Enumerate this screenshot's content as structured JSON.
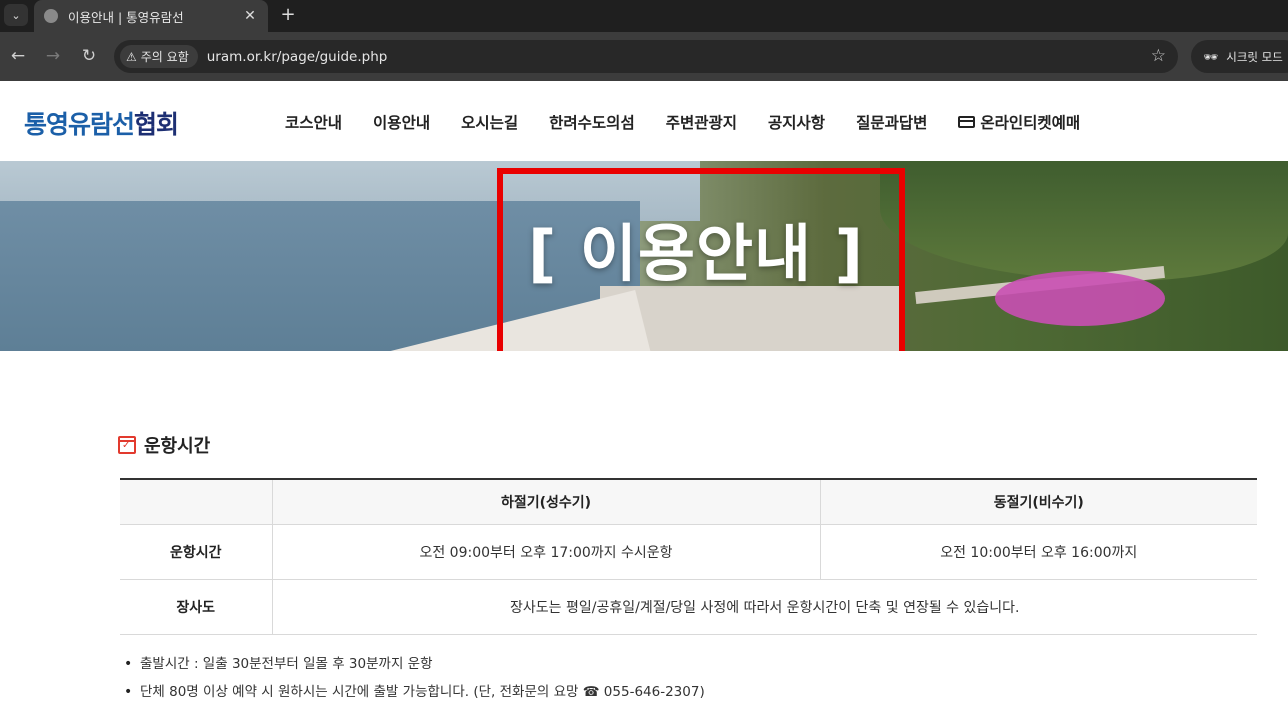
{
  "browser": {
    "tab_title": "이용안내 | 통영유람선",
    "security_label": "주의 요함",
    "url": "uram.or.kr/page/guide.php",
    "incognito_label": "시크릿 모드"
  },
  "header": {
    "logo_main": "통영유람선",
    "logo_accent": "협회",
    "nav": [
      "코스안내",
      "이용안내",
      "오시는길",
      "한려수도의섬",
      "주변관광지",
      "공지사항",
      "질문과답변",
      "온라인티켓예매"
    ]
  },
  "hero": {
    "title": "[ 이용안내 ]",
    "highlight_color": "#e90000"
  },
  "section": {
    "title": "운항시간",
    "icon": "calendar-check-icon",
    "table": {
      "headers": [
        "",
        "하절기(성수기)",
        "동절기(비수기)"
      ],
      "rows": [
        {
          "label": "운항시간",
          "cells": [
            "오전 09:00부터 오후 17:00까지 수시운항",
            "오전 10:00부터 오후 16:00까지"
          ]
        },
        {
          "label": "장사도",
          "cells": [
            "장사도는 평일/공휴일/계절/당일 사정에 따라서 운항시간이 단축 및 연장될 수 있습니다."
          ]
        }
      ]
    },
    "notes": [
      "출발시간 : 일출 30분전부터 일몰 후 30분까지 운항",
      "단체 80명 이상 예약 시 원하시는 시간에 출발 가능합니다. (단, 전화문의 요망 ☎ 055-646-2307)"
    ]
  },
  "colors": {
    "logo_blue": "#1b5fa8",
    "logo_navy": "#1d2f73",
    "icon_red": "#e23a2e"
  }
}
